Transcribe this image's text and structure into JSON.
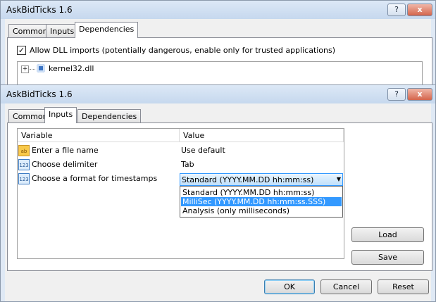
{
  "back_window": {
    "title": "AskBidTicks 1.6",
    "help_glyph": "?",
    "close_glyph": "x",
    "tabs": [
      {
        "label": "Common"
      },
      {
        "label": "Inputs"
      },
      {
        "label": "Dependencies"
      }
    ],
    "active_tab": "Dependencies",
    "allow_dll": {
      "label": "Allow DLL imports (potentially dangerous, enable only for trusted applications)",
      "checked": true,
      "glyph": "✓"
    },
    "tree_expander": "+",
    "tree_item": "kernel32.dll"
  },
  "front_window": {
    "title": "AskBidTicks 1.6",
    "help_glyph": "?",
    "close_glyph": "x",
    "tabs": [
      {
        "label": "Common"
      },
      {
        "label": "Inputs"
      },
      {
        "label": "Dependencies"
      }
    ],
    "active_tab": "Inputs",
    "table": {
      "columns": [
        {
          "label": "Variable"
        },
        {
          "label": "Value"
        }
      ],
      "rows": [
        {
          "icon": "ab",
          "icon_name": "string-type-icon",
          "variable": "Enter a file name",
          "value": "Use default"
        },
        {
          "icon": "123",
          "icon_name": "number-type-icon",
          "variable": "Choose delimiter",
          "value": "Tab"
        },
        {
          "icon": "123",
          "icon_name": "number-type-icon",
          "variable": "Choose a format for timestamps",
          "value": "Standard  (YYYY.MM.DD hh:mm:ss)"
        }
      ]
    },
    "dropdown": {
      "arrow_glyph": "▼",
      "options": [
        {
          "label": "Standard  (YYYY.MM.DD hh:mm:ss)"
        },
        {
          "label": "MilliSec  (YYYY.MM.DD hh:mm:ss.SSS)"
        },
        {
          "label": "Analysis  (only milliseconds)"
        }
      ],
      "highlighted_index": 1
    },
    "side_buttons": {
      "load": "Load",
      "save": "Save"
    },
    "footer_buttons": {
      "ok": "OK",
      "cancel": "Cancel",
      "reset": "Reset"
    }
  },
  "colors": {
    "selection": "#3399ff",
    "dropdown_highlight": "#c4e1fb",
    "frame": "#dfe9f5"
  }
}
